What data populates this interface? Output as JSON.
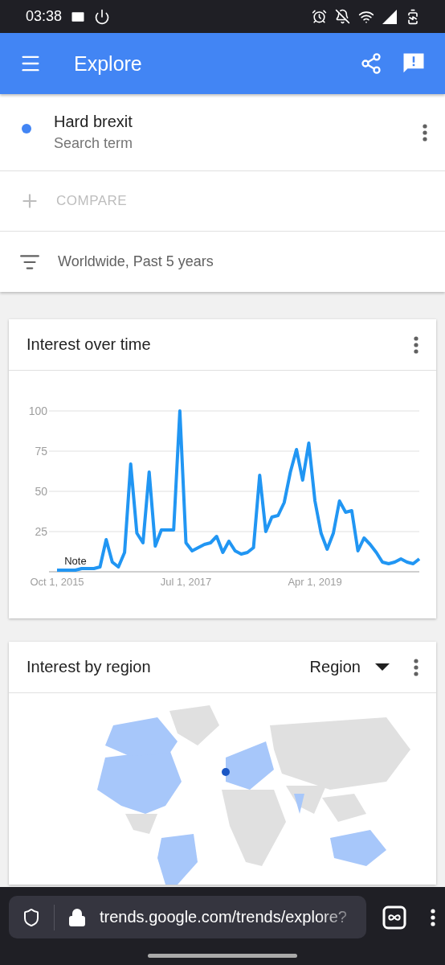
{
  "status_bar": {
    "time": "03:38"
  },
  "app_bar": {
    "title": "Explore"
  },
  "search_term": {
    "name": "Hard brexit",
    "subtitle": "Search term",
    "color": "#4285f4"
  },
  "compare": {
    "label": "COMPARE"
  },
  "filter": {
    "label": "Worldwide, Past 5 years"
  },
  "interest_over_time": {
    "title": "Interest over time",
    "chart_data": {
      "type": "line",
      "categories": [
        "Oct 1, 2015",
        null,
        null,
        null,
        null,
        null,
        null,
        null,
        null,
        null,
        null,
        null,
        null,
        null,
        null,
        null,
        null,
        null,
        null,
        null,
        null,
        "Jul 1, 2017",
        null,
        null,
        null,
        null,
        null,
        null,
        null,
        null,
        null,
        null,
        null,
        null,
        null,
        null,
        null,
        null,
        null,
        null,
        null,
        null,
        "Apr 1, 2019",
        null,
        null,
        null,
        null,
        null,
        null,
        null,
        null,
        null,
        null,
        null,
        null,
        null,
        null,
        null,
        null,
        null
      ],
      "series": [
        {
          "color": "#2196f3",
          "values": [
            1,
            1,
            1,
            1,
            2,
            2,
            2,
            3,
            20,
            6,
            3,
            12,
            67,
            24,
            18,
            62,
            16,
            26,
            26,
            26,
            100,
            18,
            13,
            15,
            17,
            18,
            22,
            12,
            19,
            13,
            11,
            12,
            15,
            60,
            25,
            34,
            35,
            43,
            62,
            76,
            57,
            80,
            44,
            24,
            14,
            24,
            44,
            37,
            38,
            13,
            21,
            17,
            12,
            6,
            5,
            6,
            8,
            6,
            5,
            8
          ]
        }
      ],
      "ylim": [
        0,
        100
      ],
      "yticks": [
        25,
        50,
        75,
        100
      ],
      "grid": true,
      "annotations": [
        "Note"
      ]
    }
  },
  "interest_by_region": {
    "title": "Interest by region",
    "dropdown": "Region"
  },
  "browser_bar": {
    "url": "trends.google.com/trends/explore?"
  }
}
